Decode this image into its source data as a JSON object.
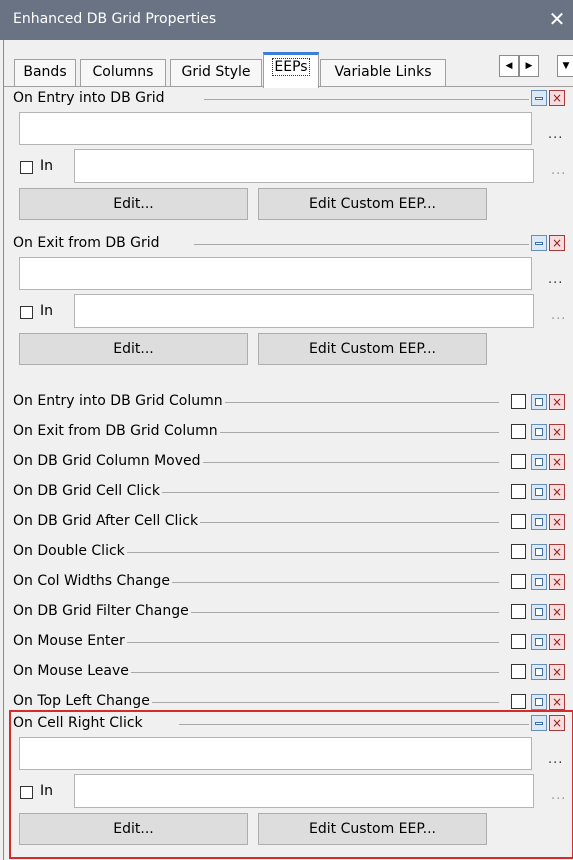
{
  "window": {
    "title": "Enhanced DB Grid Properties",
    "close_glyph": "✕"
  },
  "tabs": [
    {
      "label": "Bands"
    },
    {
      "label": "Columns"
    },
    {
      "label": "Grid Style"
    },
    {
      "label": "EEPs",
      "active": true
    },
    {
      "label": "Variable Links"
    }
  ],
  "scroll": {
    "left": "◀",
    "right": "▶",
    "menu": "▼"
  },
  "expanded_events": [
    {
      "label": "On Entry into DB Grid",
      "value": "",
      "in_label": "In",
      "in_value": "",
      "ellipsis": "...",
      "edit_label": "Edit...",
      "custom_label": "Edit Custom EEP..."
    },
    {
      "label": "On Exit from DB Grid",
      "value": "",
      "in_label": "In",
      "in_value": "",
      "ellipsis": "...",
      "edit_label": "Edit...",
      "custom_label": "Edit Custom EEP..."
    }
  ],
  "collapsed_events": [
    {
      "label": "On Entry into DB Grid Column"
    },
    {
      "label": "On Exit from DB Grid Column"
    },
    {
      "label": "On DB Grid Column Moved"
    },
    {
      "label": "On DB Grid Cell Click"
    },
    {
      "label": "On DB Grid After Cell Click"
    },
    {
      "label": "On Double Click"
    },
    {
      "label": "On Col Widths Change"
    },
    {
      "label": "On DB Grid Filter Change"
    },
    {
      "label": "On Mouse Enter"
    },
    {
      "label": "On Mouse Leave"
    },
    {
      "label": "On Top Left Change"
    }
  ],
  "highlighted_event": {
    "label": "On Cell Right Click",
    "value": "",
    "in_label": "In",
    "in_value": "",
    "ellipsis": "...",
    "edit_label": "Edit...",
    "custom_label": "Edit Custom EEP..."
  },
  "colors": {
    "titlebar": "#697383",
    "active_tab_accent": "#3c7fd9",
    "highlight_border": "#d62b2b"
  }
}
